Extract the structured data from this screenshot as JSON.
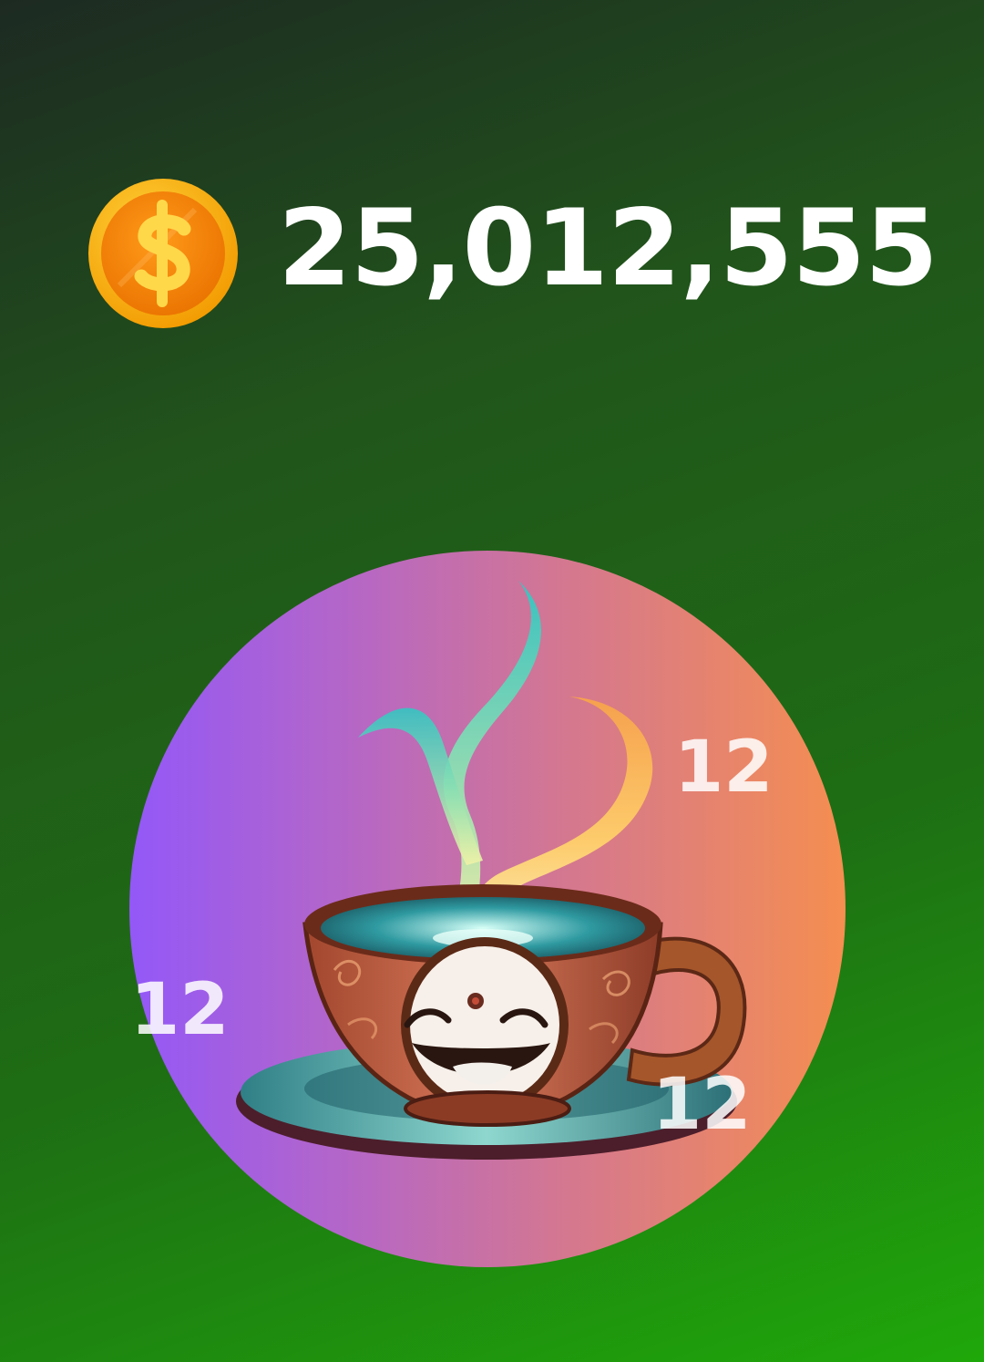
{
  "balance": {
    "icon": "dollar-coin-icon",
    "value": "25,012,555"
  },
  "tap_area": {
    "icon": "smiling-teacup-icon"
  },
  "tap_popups": [
    {
      "value": "12"
    },
    {
      "value": "12"
    },
    {
      "value": "12"
    }
  ],
  "colors": {
    "background_top": "#1d2a22",
    "background_bottom": "#1fa80a",
    "circle_left": "#9358f8",
    "circle_right": "#f58e50",
    "coin": "#f7b500",
    "text": "#ffffff"
  }
}
